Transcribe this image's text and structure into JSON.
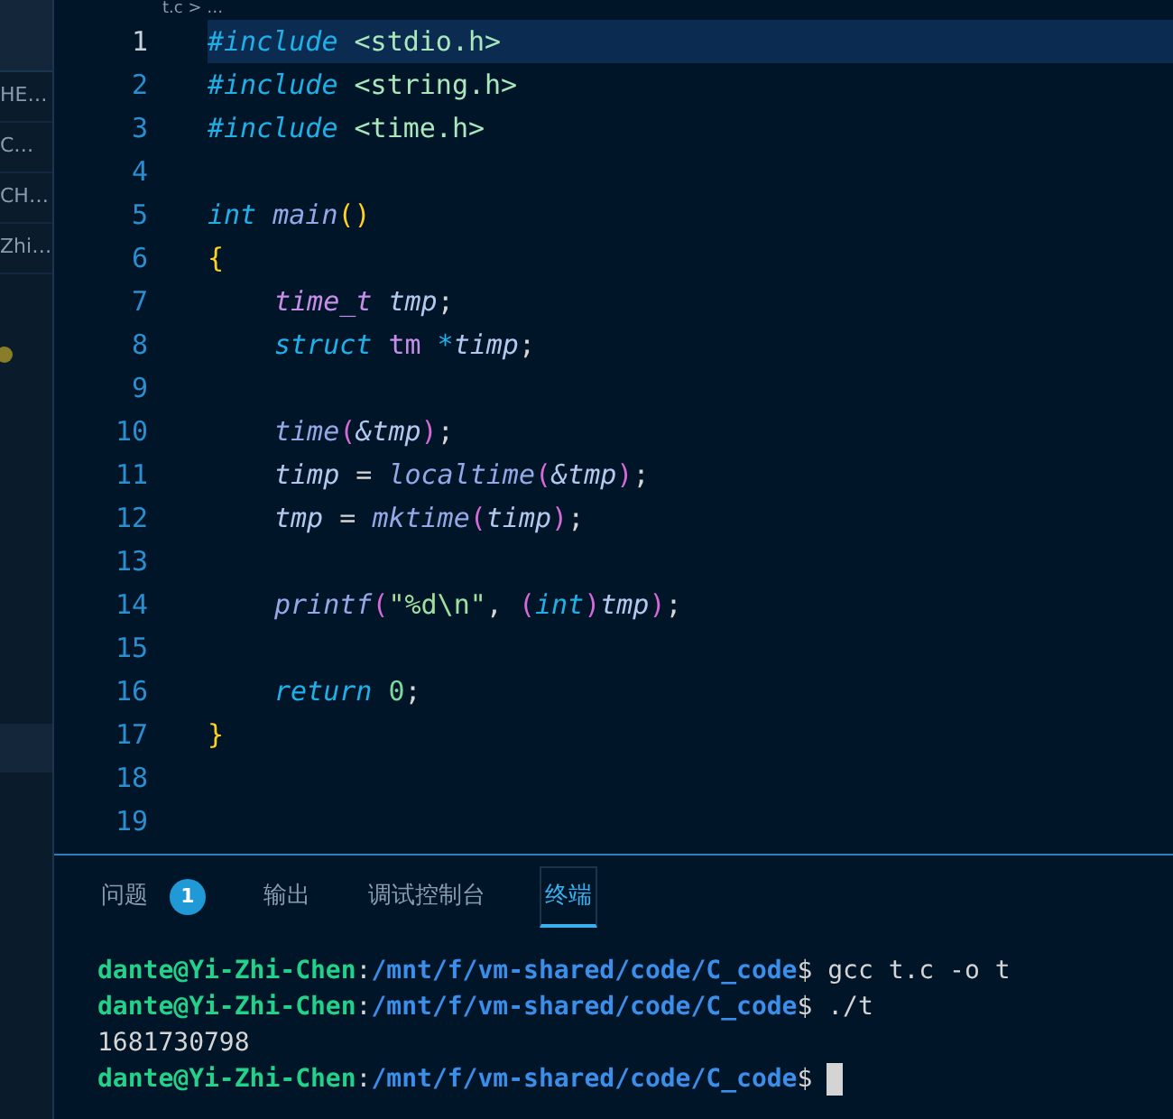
{
  "breadcrumb": {
    "text": "t.c > …"
  },
  "sidebar": {
    "items": [
      {
        "label": "HE…"
      },
      {
        "label": "C…"
      },
      {
        "label": "CH…"
      },
      {
        "label": "Zhi…"
      }
    ]
  },
  "editor": {
    "lines": [
      {
        "number": "1",
        "selected": true,
        "indented": false,
        "tokens": [
          {
            "text": "#include",
            "kind": "keyword"
          },
          {
            "text": " <stdio.h>",
            "kind": "header"
          }
        ]
      },
      {
        "number": "2",
        "selected": false,
        "indented": false,
        "tokens": [
          {
            "text": "#include",
            "kind": "keyword"
          },
          {
            "text": " <string.h>",
            "kind": "header"
          }
        ]
      },
      {
        "number": "3",
        "selected": false,
        "indented": false,
        "tokens": [
          {
            "text": "#include",
            "kind": "keyword"
          },
          {
            "text": " <time.h>",
            "kind": "header"
          }
        ]
      },
      {
        "number": "4",
        "selected": false
      },
      {
        "number": "5",
        "selected": false,
        "indented": false,
        "tokens": [
          {
            "text": "int",
            "kind": "keyword"
          },
          {
            "text": " main",
            "kind": "func"
          },
          {
            "text": "()",
            "kind": "brace"
          }
        ]
      },
      {
        "number": "6",
        "selected": false,
        "indented": false,
        "tokens": [
          {
            "text": "{",
            "kind": "brace"
          }
        ]
      },
      {
        "number": "7",
        "selected": false,
        "indented": true,
        "tokens": [
          {
            "text": "time_t",
            "kind": "type"
          },
          {
            "text": " tmp",
            "kind": "var"
          },
          {
            "text": ";",
            "kind": "plain"
          }
        ]
      },
      {
        "number": "8",
        "selected": false,
        "indented": true,
        "tokens": [
          {
            "text": "struct",
            "kind": "keyword"
          },
          {
            "text": " tm",
            "kind": "typename"
          },
          {
            "text": " *",
            "kind": "keyword"
          },
          {
            "text": "timp",
            "kind": "var"
          },
          {
            "text": ";",
            "kind": "plain"
          }
        ]
      },
      {
        "number": "9",
        "selected": false
      },
      {
        "number": "10",
        "selected": false,
        "indented": true,
        "tokens": [
          {
            "text": "time",
            "kind": "func"
          },
          {
            "text": "(",
            "kind": "paren"
          },
          {
            "text": "&tmp",
            "kind": "var"
          },
          {
            "text": ")",
            "kind": "paren"
          },
          {
            "text": ";",
            "kind": "plain"
          }
        ]
      },
      {
        "number": "11",
        "selected": false,
        "indented": true,
        "tokens": [
          {
            "text": "timp",
            "kind": "var"
          },
          {
            "text": " = ",
            "kind": "plain"
          },
          {
            "text": "localtime",
            "kind": "func"
          },
          {
            "text": "(",
            "kind": "paren"
          },
          {
            "text": "&tmp",
            "kind": "var"
          },
          {
            "text": ")",
            "kind": "paren"
          },
          {
            "text": ";",
            "kind": "plain"
          }
        ]
      },
      {
        "number": "12",
        "selected": false,
        "indented": true,
        "tokens": [
          {
            "text": "tmp",
            "kind": "var"
          },
          {
            "text": " = ",
            "kind": "plain"
          },
          {
            "text": "mktime",
            "kind": "func"
          },
          {
            "text": "(",
            "kind": "paren"
          },
          {
            "text": "timp",
            "kind": "var"
          },
          {
            "text": ")",
            "kind": "paren"
          },
          {
            "text": ";",
            "kind": "plain"
          }
        ]
      },
      {
        "number": "13",
        "selected": false
      },
      {
        "number": "14",
        "selected": false,
        "indented": true,
        "tokens": [
          {
            "text": "printf",
            "kind": "func"
          },
          {
            "text": "(",
            "kind": "paren"
          },
          {
            "text": "\"%d\\n\"",
            "kind": "string"
          },
          {
            "text": ", ",
            "kind": "plain"
          },
          {
            "text": "(",
            "kind": "paren"
          },
          {
            "text": "int",
            "kind": "keyword"
          },
          {
            "text": ")",
            "kind": "paren"
          },
          {
            "text": "tmp",
            "kind": "var"
          },
          {
            "text": ")",
            "kind": "paren"
          },
          {
            "text": ";",
            "kind": "plain"
          }
        ]
      },
      {
        "number": "15",
        "selected": false
      },
      {
        "number": "16",
        "selected": false,
        "indented": true,
        "tokens": [
          {
            "text": "return",
            "kind": "keyword"
          },
          {
            "text": " 0",
            "kind": "number"
          },
          {
            "text": ";",
            "kind": "plain"
          }
        ]
      },
      {
        "number": "17",
        "selected": false,
        "indented": false,
        "tokens": [
          {
            "text": "}",
            "kind": "brace"
          }
        ]
      },
      {
        "number": "18",
        "selected": false
      },
      {
        "number": "19",
        "selected": false
      }
    ]
  },
  "panel": {
    "tabs": [
      {
        "label": "问题",
        "badge": "1",
        "selected": false
      },
      {
        "label": "输出",
        "selected": false
      },
      {
        "label": "调试控制台",
        "selected": false
      },
      {
        "label": "终端",
        "selected": true
      }
    ],
    "terminal": [
      {
        "kind": "prompt",
        "user": "dante@Yi-Zhi-Chen",
        "sep": ":",
        "path": "/mnt/f/vm-shared/code/C_code",
        "command": "$ gcc t.c -o t"
      },
      {
        "kind": "prompt",
        "user": "dante@Yi-Zhi-Chen",
        "sep": ":",
        "path": "/mnt/f/vm-shared/code/C_code",
        "command": "$ ./t"
      },
      {
        "kind": "output",
        "text": "1681730798"
      },
      {
        "kind": "prompt",
        "user": "dante@Yi-Zhi-Chen",
        "sep": ":",
        "path": "/mnt/f/vm-shared/code/C_code",
        "command": "$",
        "cursor": true
      }
    ]
  }
}
